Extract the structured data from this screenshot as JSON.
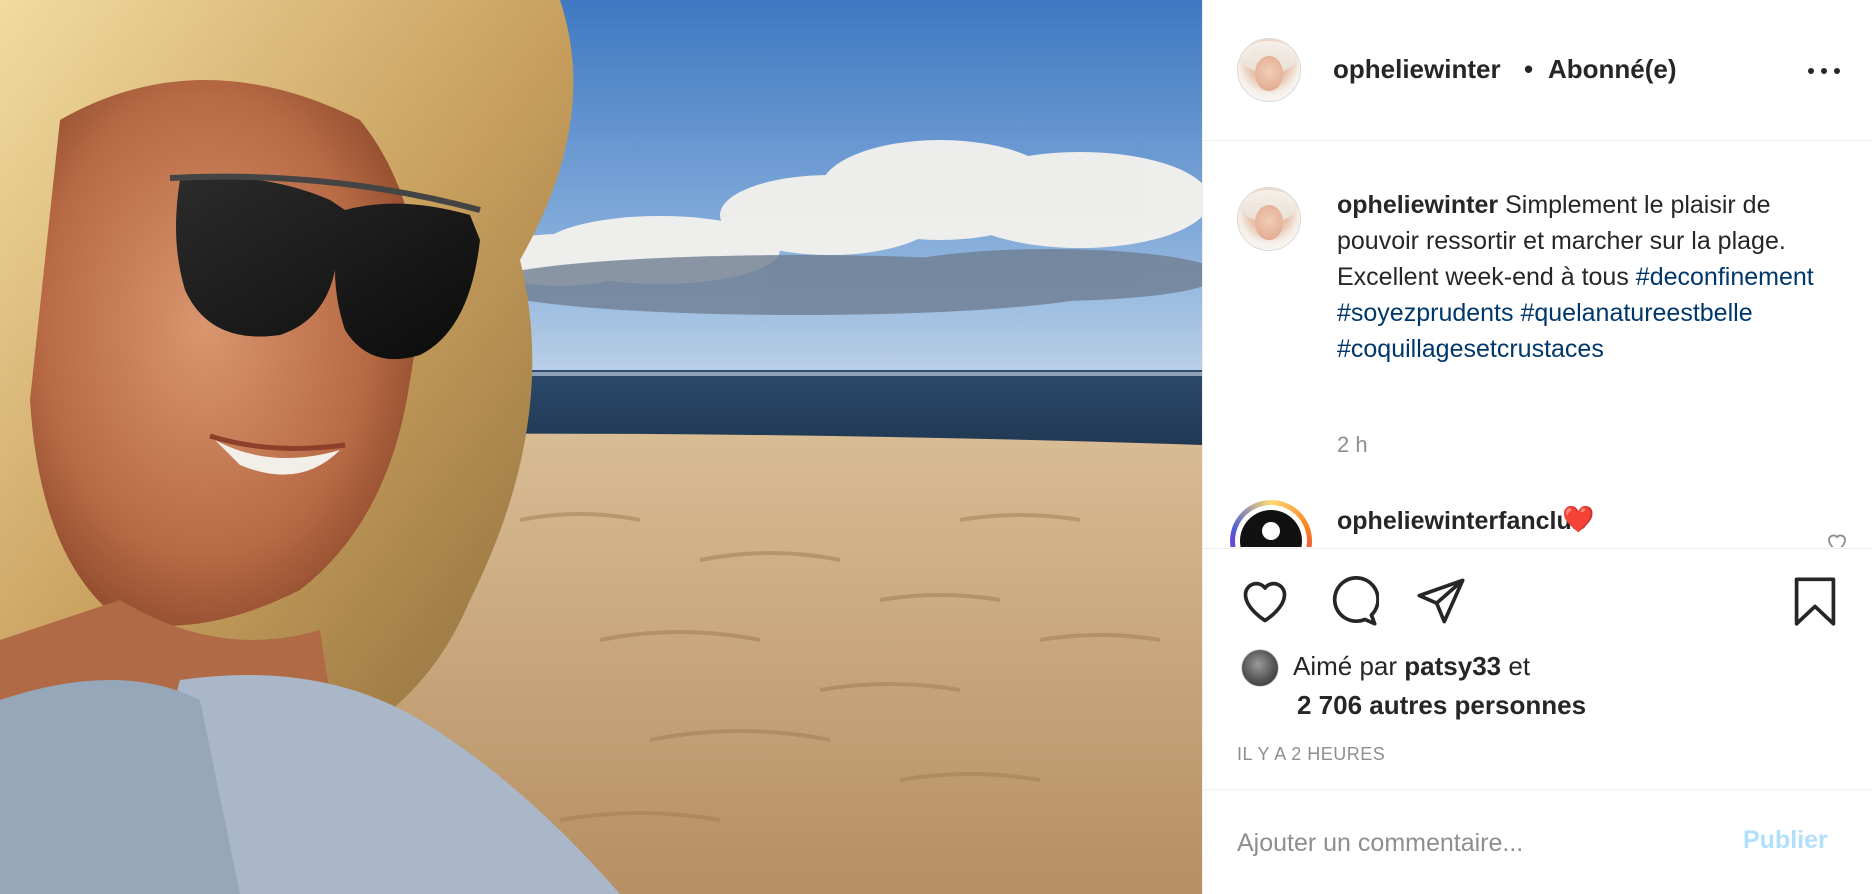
{
  "photo": {
    "alt_subject": "selfie-beach"
  },
  "header": {
    "username": "opheliewinter",
    "separator": "•",
    "follow_status": "Abonné(e)",
    "more_icon": "more-horizontal-icon"
  },
  "caption": {
    "username": "opheliewinter",
    "text": "Simplement le plaisir de pouvoir ressortir et marcher sur la plage. Excellent week-end à tous",
    "hashtags": [
      "#deconfinement",
      "#soyezprudents",
      "#quelanatureestbelle",
      "#coquillagesetcrustaces"
    ],
    "time": "2 h"
  },
  "comment": {
    "username": "opheliewinterfanclub",
    "text": "❤️"
  },
  "actions": {
    "like_icon": "heart-icon",
    "comment_icon": "comment-icon",
    "share_icon": "send-icon",
    "save_icon": "bookmark-icon"
  },
  "likes": {
    "prefix": "Aimé par",
    "first_liker": "patsy33",
    "conjunction": "et",
    "others": "2 706 autres personnes"
  },
  "timestamp": "IL Y A 2 HEURES",
  "comment_box": {
    "placeholder": "Ajouter un commentaire...",
    "publish_label": "Publier"
  },
  "colors": {
    "hashtag": "#00376b",
    "publish_disabled": "#b2dffc",
    "muted": "#8e8e8e",
    "text": "#262626"
  }
}
